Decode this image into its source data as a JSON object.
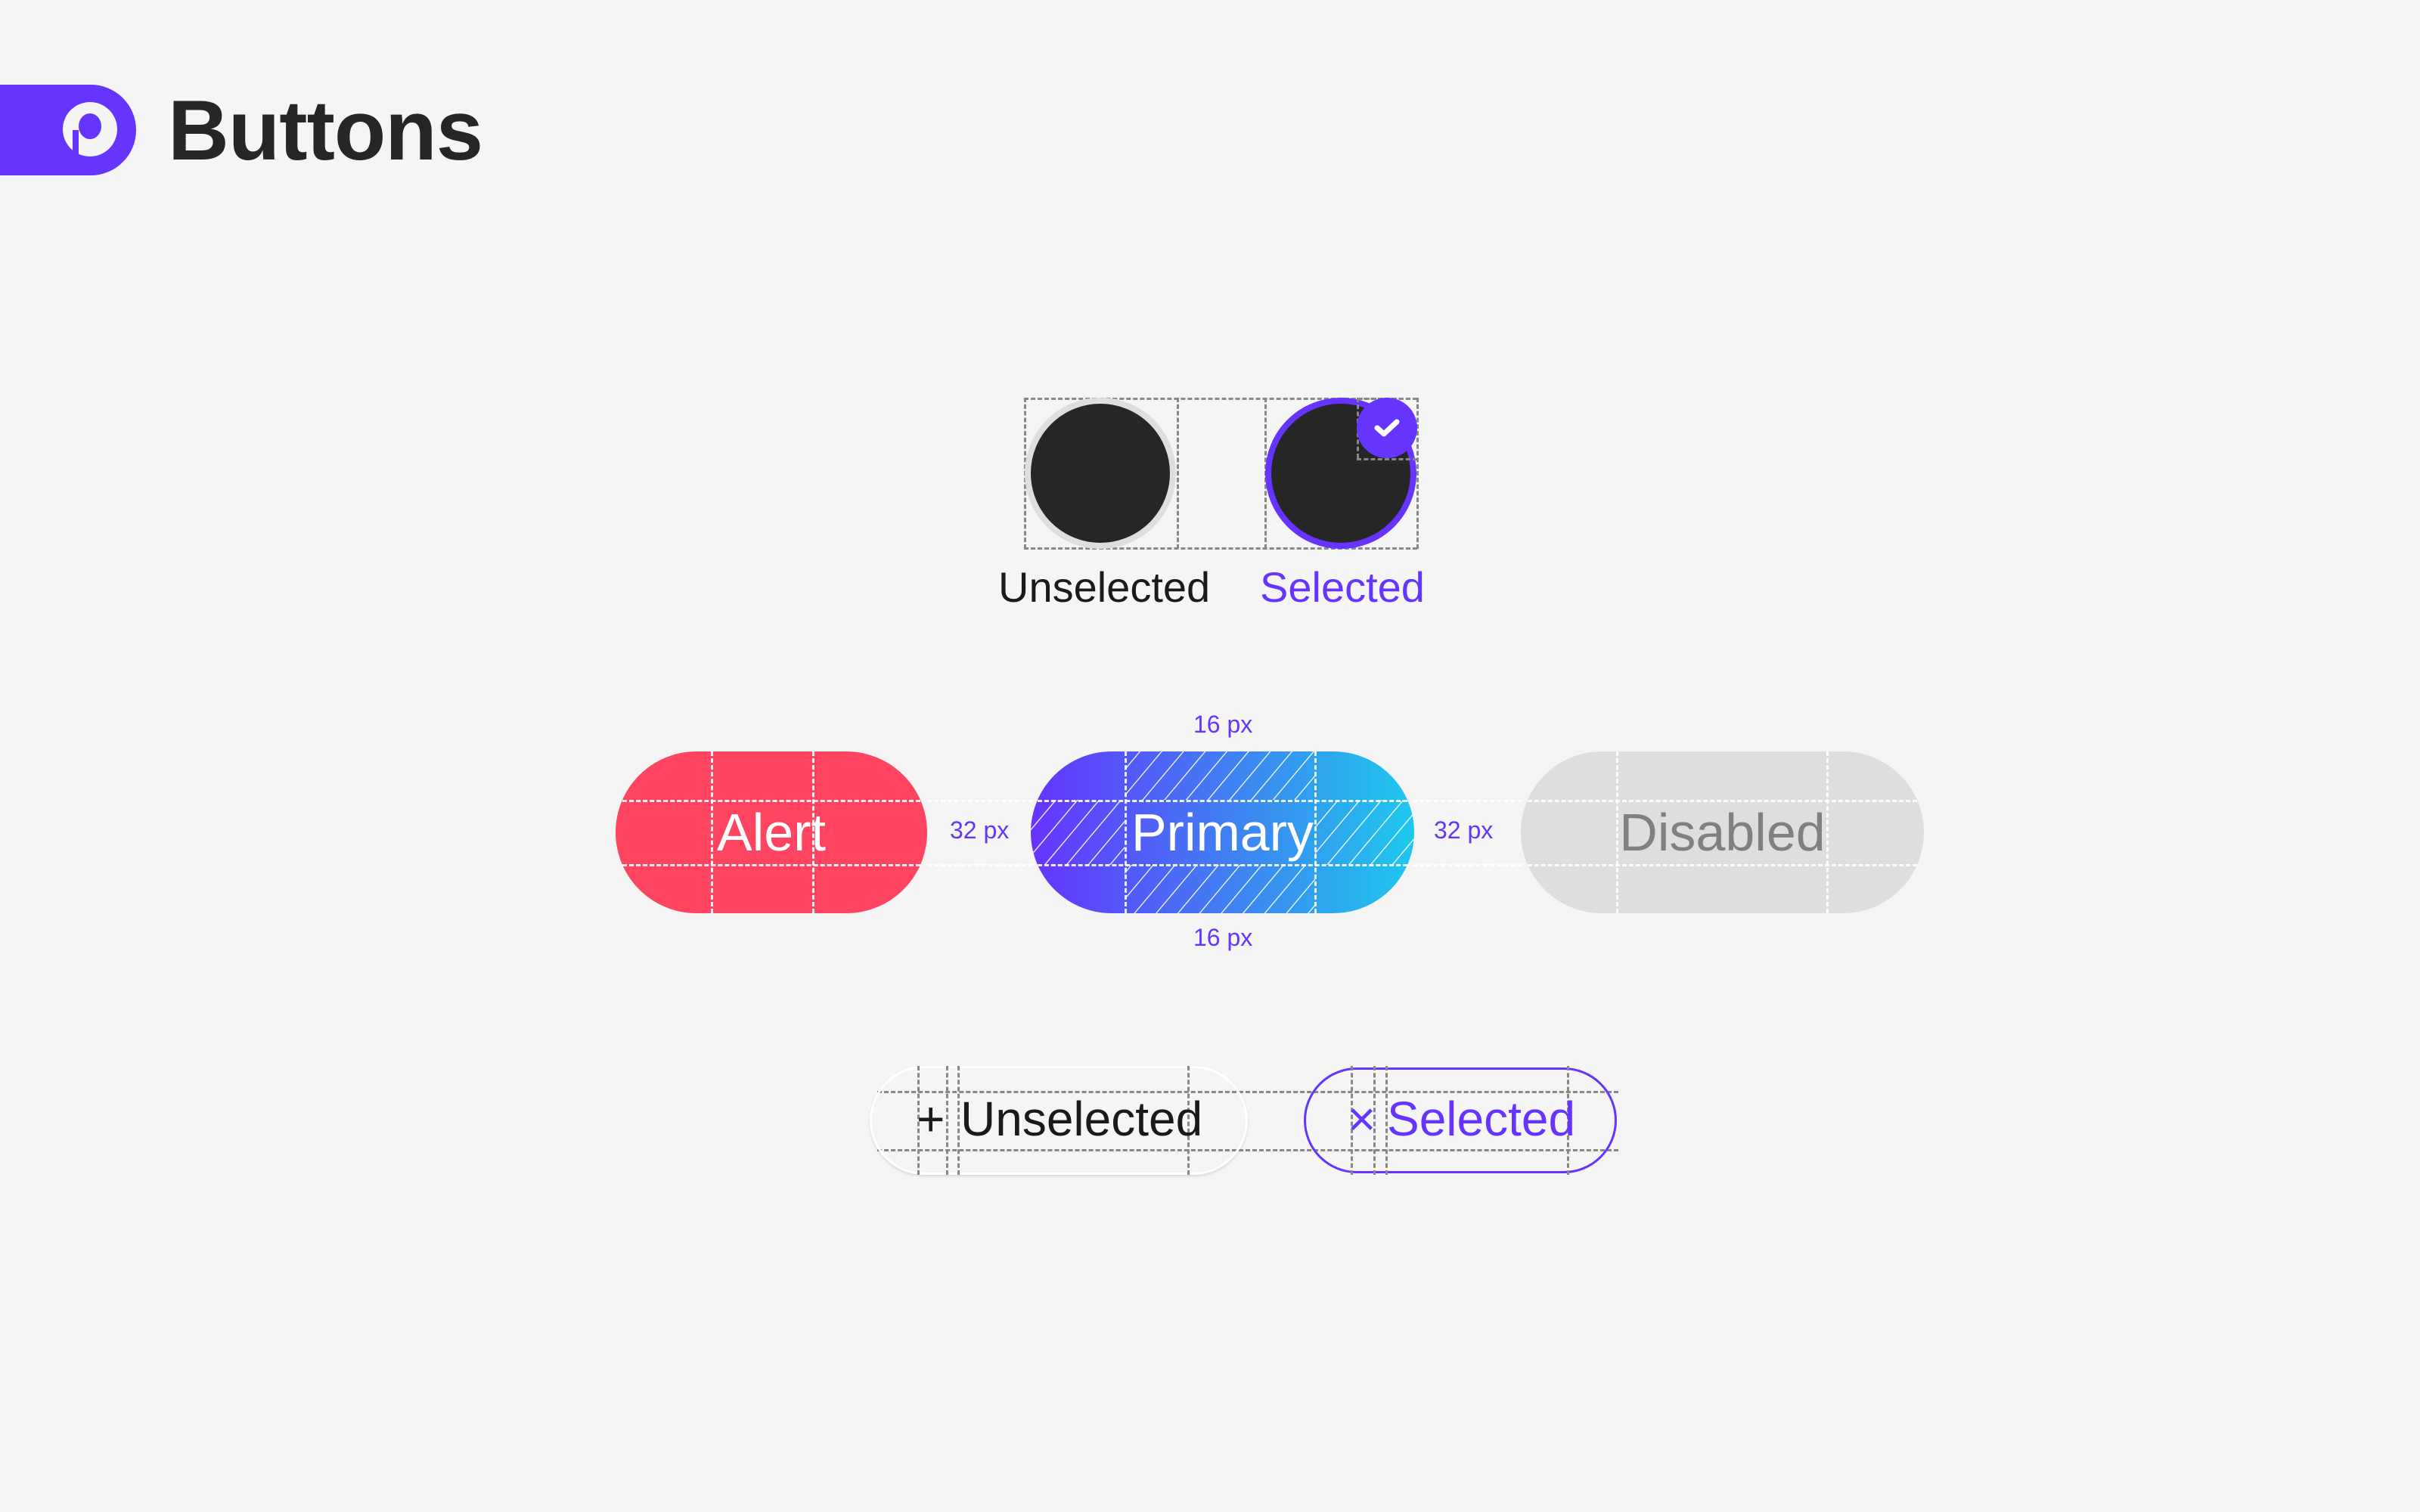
{
  "header": {
    "logo_icon": "brand-p-logo-icon",
    "title": "Buttons"
  },
  "colors": {
    "brand": "#6633ff",
    "alert": "#ff4461",
    "primary_gradient_start": "#6633ff",
    "primary_gradient_end": "#1ec8ee",
    "disabled_bg": "#dedede",
    "disabled_text": "#808080",
    "text_dark": "#262626",
    "background": "#f5f5f5"
  },
  "avatar_toggle": {
    "unselected_label": "Unselected",
    "selected_label": "Selected",
    "selected_badge_icon": "check-icon"
  },
  "buttons": {
    "alert_label": "Alert",
    "primary_label": "Primary",
    "disabled_label": "Disabled",
    "spacing_left": "32 px",
    "spacing_right": "32 px",
    "padding_top": "16 px",
    "padding_bottom": "16 px"
  },
  "chips": {
    "unselected": {
      "icon": "plus-icon",
      "glyph": "+",
      "label": "Unselected"
    },
    "selected": {
      "icon": "close-icon",
      "glyph": "×",
      "label": "Selected"
    }
  }
}
